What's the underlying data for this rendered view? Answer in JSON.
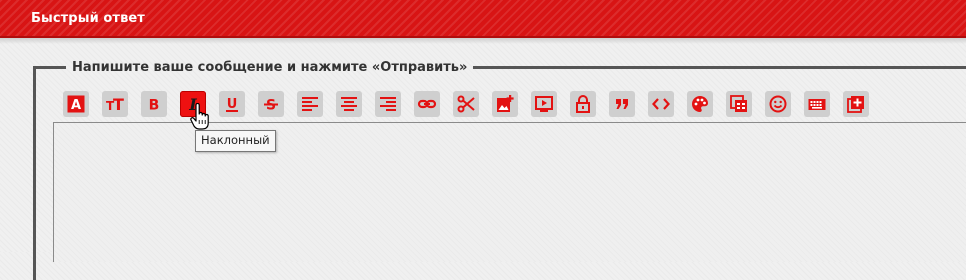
{
  "header": {
    "title": "Быстрый ответ"
  },
  "form": {
    "legend": "Напишите ваше сообщение и нажмите «Отправить»"
  },
  "editor": {
    "value": ""
  },
  "tooltip": {
    "text": "Наклонный"
  },
  "colors": {
    "accent": "#e31212",
    "button_bg": "#cfcfcf"
  },
  "toolbar": {
    "active_button": "italic",
    "buttons": [
      {
        "id": "font-color",
        "icon": "font-color-icon"
      },
      {
        "id": "font-size",
        "icon": "font-size-icon"
      },
      {
        "id": "bold",
        "icon": "bold-icon"
      },
      {
        "id": "italic",
        "icon": "italic-icon"
      },
      {
        "id": "underline",
        "icon": "underline-icon"
      },
      {
        "id": "strikethrough",
        "icon": "strikethrough-icon"
      },
      {
        "id": "align-left",
        "icon": "align-left-icon"
      },
      {
        "id": "align-center",
        "icon": "align-center-icon"
      },
      {
        "id": "align-right",
        "icon": "align-right-icon"
      },
      {
        "id": "link",
        "icon": "link-icon"
      },
      {
        "id": "cut",
        "icon": "scissors-icon"
      },
      {
        "id": "insert-image",
        "icon": "add-image-icon"
      },
      {
        "id": "insert-video",
        "icon": "video-icon"
      },
      {
        "id": "spoiler",
        "icon": "lock-icon"
      },
      {
        "id": "quote",
        "icon": "quote-icon"
      },
      {
        "id": "code",
        "icon": "code-icon"
      },
      {
        "id": "color-palette",
        "icon": "palette-icon"
      },
      {
        "id": "table",
        "icon": "table-icon"
      },
      {
        "id": "smilies",
        "icon": "smiley-icon"
      },
      {
        "id": "keyboard",
        "icon": "keyboard-icon"
      },
      {
        "id": "add-more",
        "icon": "add-box-icon"
      }
    ]
  }
}
